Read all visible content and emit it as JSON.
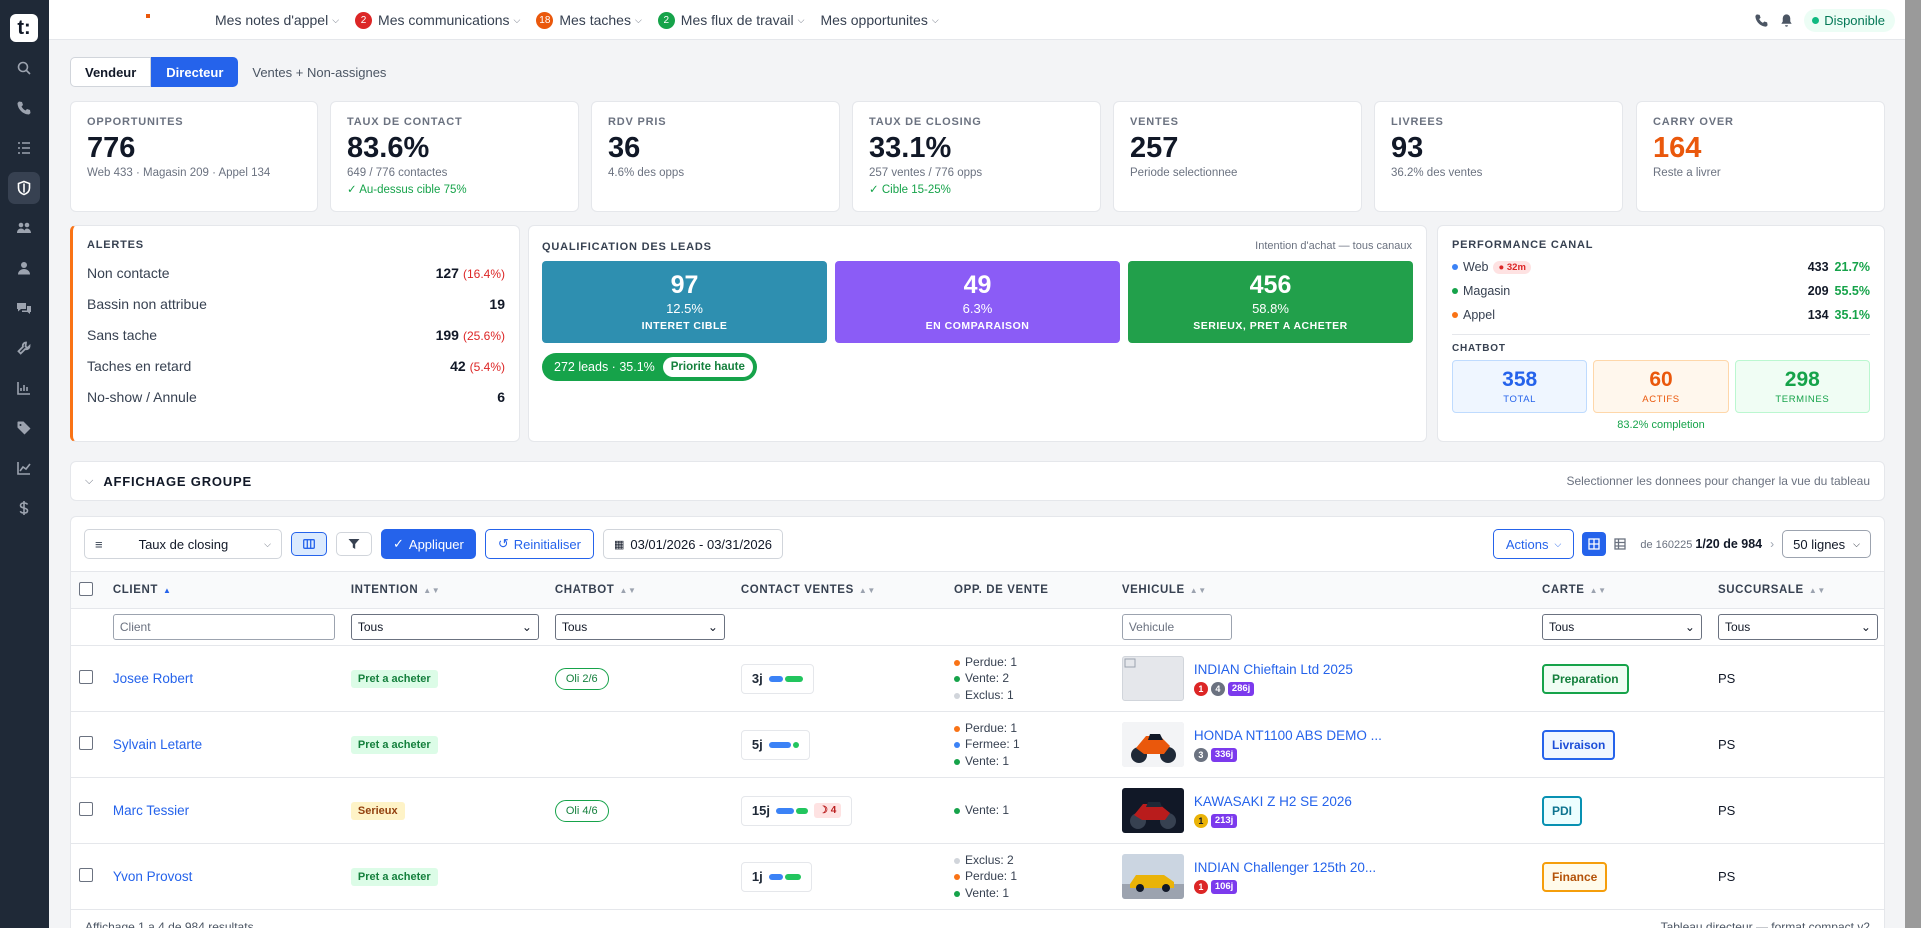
{
  "topbar": {
    "nav": [
      {
        "label": "Mes notes d'appel",
        "badge": "",
        "badge_color": ""
      },
      {
        "label": "Mes communications",
        "badge": "2",
        "badge_color": "#dc2626"
      },
      {
        "label": "Mes taches",
        "badge": "18",
        "badge_color": "#ea580c"
      },
      {
        "label": "Mes flux de travail",
        "badge": "2",
        "badge_color": "#16a34a"
      },
      {
        "label": "Mes opportunites",
        "badge": "",
        "badge_color": ""
      }
    ],
    "status": "Disponible"
  },
  "view_toggle": {
    "vendeur": "Vendeur",
    "directeur": "Directeur",
    "scope": "Ventes + Non-assignes"
  },
  "kpis": [
    {
      "label": "OPPORTUNITES",
      "value": "776",
      "sub": "Web 433 · Magasin 209 · Appel 134",
      "ok": "",
      "color": "#111827"
    },
    {
      "label": "TAUX DE CONTACT",
      "value": "83.6%",
      "sub": "649 / 776 contactes",
      "ok": "✓ Au-dessus cible 75%",
      "color": "#111827"
    },
    {
      "label": "RDV PRIS",
      "value": "36",
      "sub": "4.6% des opps",
      "ok": "",
      "color": "#111827"
    },
    {
      "label": "TAUX DE CLOSING",
      "value": "33.1%",
      "sub": "257 ventes / 776 opps",
      "ok": "✓ Cible 15-25%",
      "color": "#111827"
    },
    {
      "label": "VENTES",
      "value": "257",
      "sub": "Periode selectionnee",
      "ok": "",
      "color": "#111827"
    },
    {
      "label": "LIVREES",
      "value": "93",
      "sub": "36.2% des ventes",
      "ok": "",
      "color": "#111827"
    },
    {
      "label": "CARRY OVER",
      "value": "164",
      "sub": "Reste a livrer",
      "ok": "",
      "color": "#ea580c"
    }
  ],
  "alerts": {
    "title": "ALERTES",
    "rows": [
      {
        "label": "Non contacte",
        "value": "127",
        "pct": "(16.4%)"
      },
      {
        "label": "Bassin non attribue",
        "value": "19",
        "pct": ""
      },
      {
        "label": "Sans tache",
        "value": "199",
        "pct": "(25.6%)"
      },
      {
        "label": "Taches en retard",
        "value": "42",
        "pct": "(5.4%)"
      },
      {
        "label": "No-show / Annule",
        "value": "6",
        "pct": ""
      }
    ]
  },
  "qualification": {
    "title": "QUALIFICATION DES LEADS",
    "note": "Intention d'achat — tous canaux",
    "cards": [
      {
        "value": "97",
        "pct": "12.5%",
        "label": "INTERET CIBLE",
        "color": "#2e8fb0"
      },
      {
        "value": "49",
        "pct": "6.3%",
        "label": "EN COMPARAISON",
        "color": "#8b5cf6"
      },
      {
        "value": "456",
        "pct": "58.8%",
        "label": "SERIEUX, PRET A ACHETER",
        "color": "#22a04b"
      }
    ],
    "pill": {
      "text": "272 leads · 35.1%",
      "tag": "Priorite haute"
    }
  },
  "canal": {
    "title": "PERFORMANCE CANAL",
    "rows": [
      {
        "label": "Web",
        "tag": "32m",
        "value": "433",
        "pct": "21.7%",
        "color": "#3b82f6"
      },
      {
        "label": "Magasin",
        "tag": "",
        "value": "209",
        "pct": "55.5%",
        "color": "#16a34a"
      },
      {
        "label": "Appel",
        "tag": "",
        "value": "134",
        "pct": "35.1%",
        "color": "#f97316"
      }
    ],
    "chatbot_title": "CHATBOT",
    "chatbot": [
      {
        "value": "358",
        "label": "TOTAL",
        "color": "#2563eb",
        "bg": "#eff6ff",
        "border": "#bfdbfe"
      },
      {
        "value": "60",
        "label": "ACTIFS",
        "color": "#ea580c",
        "bg": "#fff7ed",
        "border": "#fed7aa"
      },
      {
        "value": "298",
        "label": "TERMINES",
        "color": "#16a34a",
        "bg": "#f0fdf4",
        "border": "#bbf7d0"
      }
    ],
    "completion": "83.2% completion"
  },
  "group": {
    "title": "AFFICHAGE GROUPE",
    "hint": "Selectionner les donnees pour changer la vue du tableau"
  },
  "toolbar": {
    "metric": "Taux de closing",
    "apply": "Appliquer",
    "reset": "Reinitialiser",
    "dates": "03/01/2026 - 03/31/2026",
    "actions": "Actions",
    "total_prefix": "de 160225",
    "page": "1/20 de 984",
    "lines": "50 lignes"
  },
  "table": {
    "columns": [
      "CLIENT",
      "INTENTION",
      "CHATBOT",
      "CONTACT VENTES",
      "OPP. DE VENTE",
      "VEHICULE",
      "CARTE",
      "SUCCURSALE"
    ],
    "filters": {
      "client_placeholder": "Client",
      "intention": "Tous",
      "chatbot": "Tous",
      "vehicule_placeholder": "Vehicule",
      "carte": "Tous",
      "succursale": "Tous"
    },
    "rows": [
      {
        "client": "Josee Robert",
        "intention": "Pret a acheter",
        "intent_bg": "#dcfce7",
        "intent_fg": "#15803d",
        "chatbot": "Oli 2/6",
        "contact_days": "3j",
        "moon": "",
        "opp": [
          {
            "label": "Perdue: 1",
            "color": "#f97316"
          },
          {
            "label": "Vente: 2",
            "color": "#16a34a"
          },
          {
            "label": "Exclus: 1",
            "color": "#d1d5db"
          }
        ],
        "vehicle": "INDIAN Chieftain Ltd 2025",
        "vimg": "none",
        "vbadges": [
          {
            "t": "1",
            "c": "#dc2626"
          },
          {
            "t": "4",
            "c": "#6b7280"
          }
        ],
        "vdays": "286j",
        "carte": "Preparation",
        "carte_color": "#16a34a",
        "carte_bg": "#f0fdf4",
        "succursale": "PS"
      },
      {
        "client": "Sylvain Letarte",
        "intention": "Pret a acheter",
        "intent_bg": "#dcfce7",
        "intent_fg": "#15803d",
        "chatbot": "",
        "contact_days": "5j",
        "moon": "",
        "opp": [
          {
            "label": "Perdue: 1",
            "color": "#f97316"
          },
          {
            "label": "Fermee: 1",
            "color": "#3b82f6"
          },
          {
            "label": "Vente: 1",
            "color": "#16a34a"
          }
        ],
        "vehicle": "HONDA NT1100 ABS DEMO ...",
        "vimg": "moto-orange",
        "vbadges": [
          {
            "t": "3",
            "c": "#6b7280"
          }
        ],
        "vdays": "336j",
        "carte": "Livraison",
        "carte_color": "#2563eb",
        "carte_bg": "#eff6ff",
        "succursale": "PS"
      },
      {
        "client": "Marc Tessier",
        "intention": "Serieux",
        "intent_bg": "#fef3c7",
        "intent_fg": "#92400e",
        "chatbot": "Oli 4/6",
        "contact_days": "15j",
        "moon": "4",
        "opp": [
          {
            "label": "Vente: 1",
            "color": "#16a34a"
          }
        ],
        "vehicle": "KAWASAKI Z H2 SE 2026",
        "vimg": "moto-red",
        "vbadges": [
          {
            "t": "1",
            "c": "#eab308"
          }
        ],
        "vdays": "213j",
        "carte": "PDI",
        "carte_color": "#0891b2",
        "carte_bg": "#ecfeff",
        "succursale": "PS"
      },
      {
        "client": "Yvon Provost",
        "intention": "Pret a acheter",
        "intent_bg": "#dcfce7",
        "intent_fg": "#15803d",
        "chatbot": "",
        "contact_days": "1j",
        "moon": "",
        "opp": [
          {
            "label": "Exclus: 2",
            "color": "#d1d5db"
          },
          {
            "label": "Perdue: 1",
            "color": "#f97316"
          },
          {
            "label": "Vente: 1",
            "color": "#16a34a"
          }
        ],
        "vehicle": "INDIAN Challenger 125th 20...",
        "vimg": "car-yellow",
        "vbadges": [
          {
            "t": "1",
            "c": "#dc2626"
          }
        ],
        "vdays": "106j",
        "carte": "Finance",
        "carte_color": "#f59e0b",
        "carte_bg": "#fffbeb",
        "succursale": "PS"
      }
    ]
  },
  "footer": {
    "left": "Affichage 1 a 4 de 984 resultats",
    "right": "Tableau directeur — format compact v2"
  }
}
